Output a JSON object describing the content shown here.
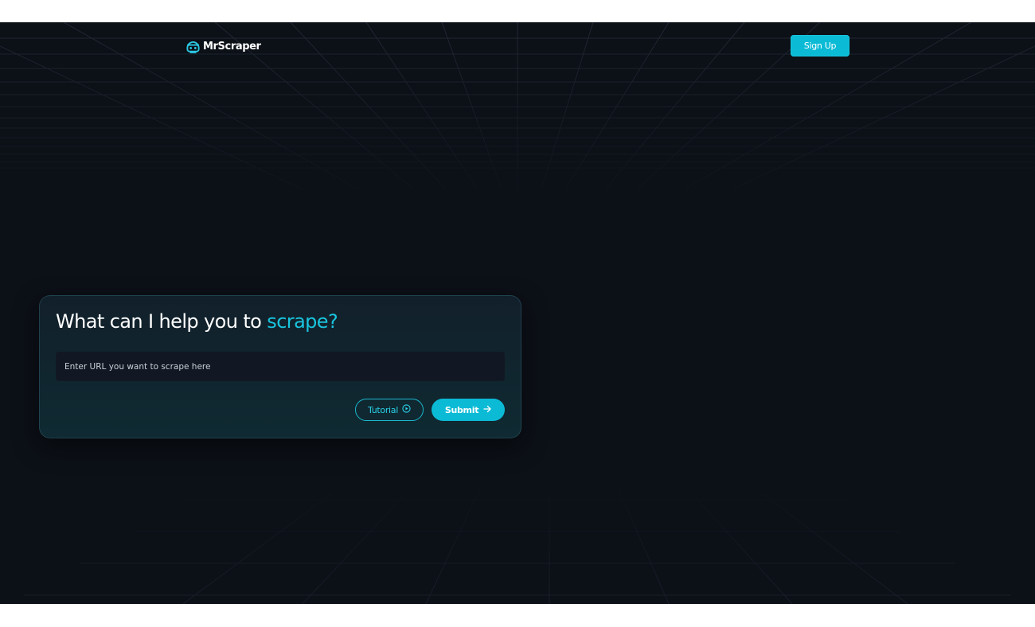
{
  "header": {
    "logo_text": "MrScraper",
    "logo_icon": "scraper-face-icon",
    "signup_label": "Sign Up"
  },
  "hero": {
    "headline_prefix": "What can I help you to ",
    "headline_accent": "scrape?",
    "url_placeholder": "Enter URL you want to scrape here",
    "url_value": "",
    "tutorial_label": "Tutorial",
    "tutorial_icon": "play-circle-icon",
    "submit_label": "Submit",
    "submit_icon": "arrow-right-icon"
  },
  "colors": {
    "background": "#0c1017",
    "accent": "#0bbbd6",
    "accent_text": "#19c4de",
    "card": "#12202b",
    "input": "#121823"
  }
}
